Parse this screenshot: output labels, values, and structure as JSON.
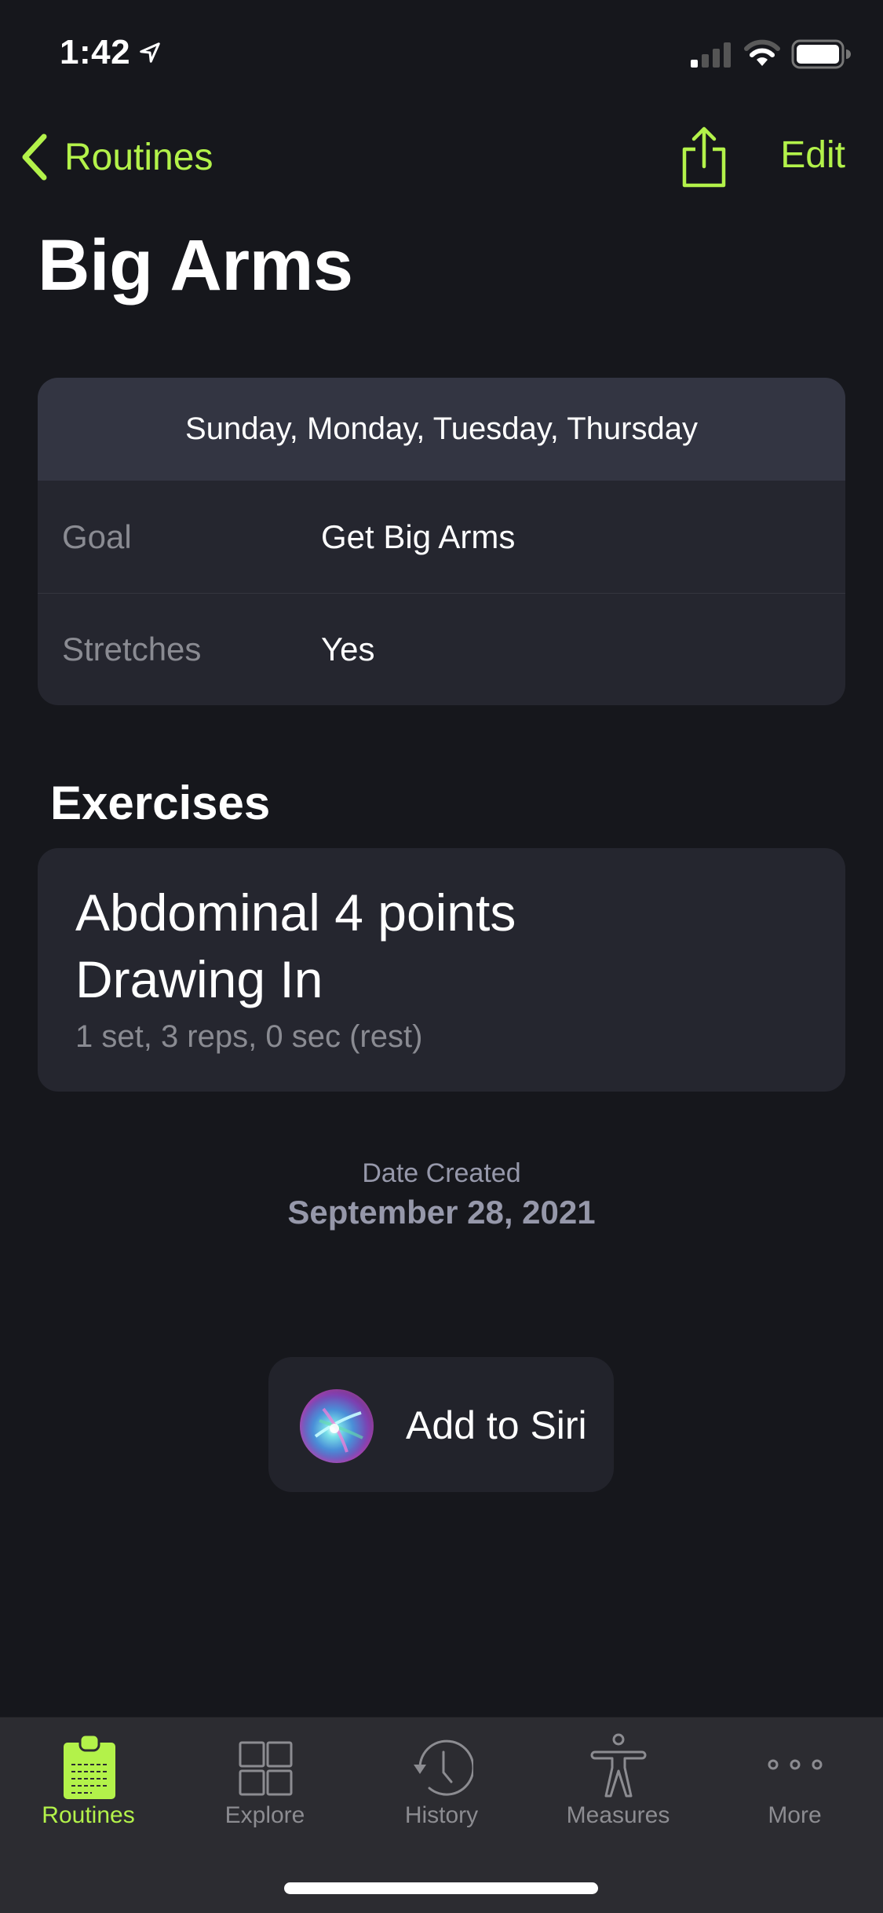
{
  "status_bar": {
    "time": "1:42",
    "location_icon": "location-arrow-icon",
    "signal_icon": "cellular-signal-icon",
    "wifi_icon": "wifi-icon",
    "battery_icon": "battery-icon"
  },
  "nav": {
    "back_label": "Routines",
    "back_icon": "chevron-left-icon",
    "share_icon": "share-icon",
    "edit_label": "Edit"
  },
  "colors": {
    "accent": "#b3f24a",
    "background": "#16171c",
    "card": "#25262f",
    "card_header": "#333542",
    "secondary_text": "#8a8b92",
    "tab_bar": "#2c2c31"
  },
  "title": "Big Arms",
  "info": {
    "days": "Sunday, Monday, Tuesday, Thursday",
    "rows": [
      {
        "label": "Goal",
        "value": "Get Big Arms"
      },
      {
        "label": "Stretches",
        "value": "Yes"
      }
    ]
  },
  "exercises": {
    "section_title": "Exercises",
    "items": [
      {
        "name": "Abdominal 4 points Drawing In",
        "detail": "1 set, 3 reps, 0 sec (rest)"
      }
    ]
  },
  "date_created": {
    "label": "Date Created",
    "value": "September 28, 2021"
  },
  "siri": {
    "label": "Add to Siri",
    "icon": "siri-icon"
  },
  "tab_bar": {
    "items": [
      {
        "label": "Routines",
        "icon": "clipboard-icon",
        "active": true
      },
      {
        "label": "Explore",
        "icon": "grid-icon",
        "active": false
      },
      {
        "label": "History",
        "icon": "history-clock-icon",
        "active": false
      },
      {
        "label": "Measures",
        "icon": "body-figure-icon",
        "active": false
      },
      {
        "label": "More",
        "icon": "more-dots-icon",
        "active": false
      }
    ]
  }
}
